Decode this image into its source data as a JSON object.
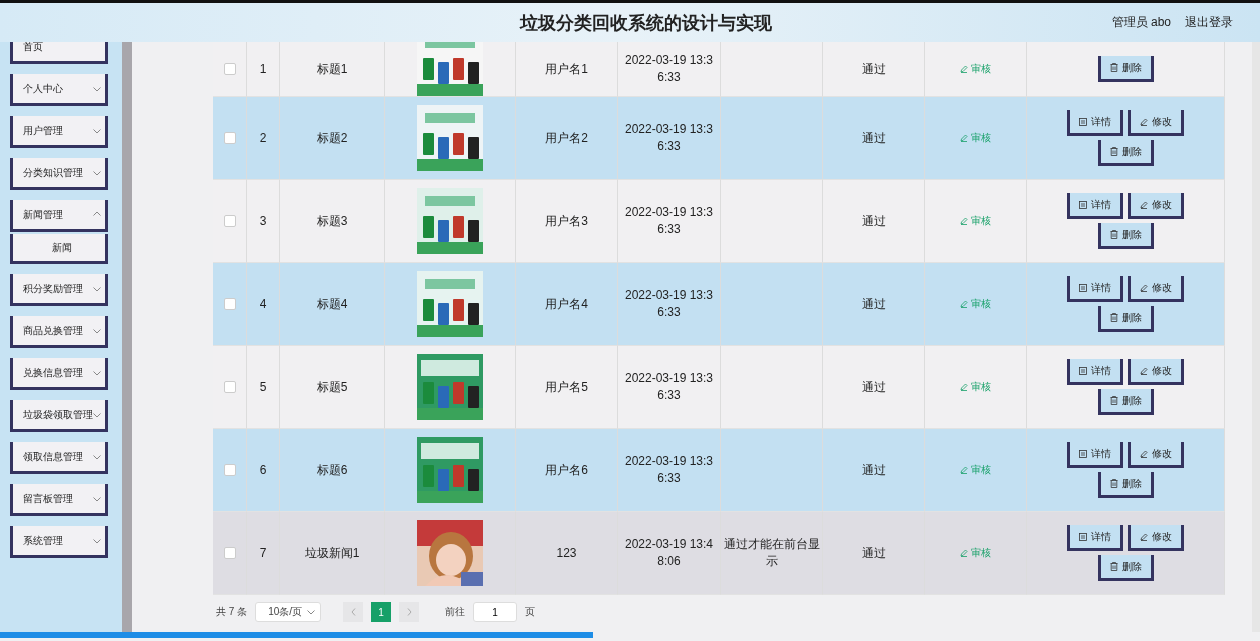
{
  "header": {
    "title": "垃圾分类回收系统的设计与实现",
    "user": "管理员 abo",
    "logout": "退出登录"
  },
  "sidebar": {
    "items": [
      {
        "label": "首页",
        "kind": "link"
      },
      {
        "label": "个人中心",
        "kind": "menu",
        "expanded": false
      },
      {
        "label": "用户管理",
        "kind": "menu",
        "expanded": false
      },
      {
        "label": "分类知识管理",
        "kind": "menu",
        "expanded": false
      },
      {
        "label": "新闻管理",
        "kind": "menu",
        "expanded": true,
        "children": [
          {
            "label": "新闻"
          }
        ]
      },
      {
        "label": "积分奖励管理",
        "kind": "menu",
        "expanded": false
      },
      {
        "label": "商品兑换管理",
        "kind": "menu",
        "expanded": false
      },
      {
        "label": "兑换信息管理",
        "kind": "menu",
        "expanded": false
      },
      {
        "label": "垃圾袋领取管理",
        "kind": "menu",
        "expanded": false
      },
      {
        "label": "领取信息管理",
        "kind": "menu",
        "expanded": false
      },
      {
        "label": "留言板管理",
        "kind": "menu",
        "expanded": false
      },
      {
        "label": "系统管理",
        "kind": "menu",
        "expanded": false
      }
    ]
  },
  "table": {
    "rows": [
      {
        "checked": false,
        "hovered": false,
        "index": "1",
        "title": "标题1",
        "username": "用户名1",
        "time": "2022-03-19 13:36:33",
        "status": "通过",
        "review": "审核",
        "actions": [
          "删除"
        ]
      },
      {
        "checked": false,
        "hovered": false,
        "index": "2",
        "title": "标题2",
        "username": "用户名2",
        "time": "2022-03-19 13:36:33",
        "status": "通过",
        "review": "审核",
        "actions": [
          "详情",
          "修改",
          "删除"
        ]
      },
      {
        "checked": false,
        "hovered": false,
        "index": "3",
        "title": "标题3",
        "username": "用户名3",
        "time": "2022-03-19 13:36:33",
        "status": "通过",
        "review": "审核",
        "actions": [
          "详情",
          "修改",
          "删除"
        ]
      },
      {
        "checked": false,
        "hovered": false,
        "index": "4",
        "title": "标题4",
        "username": "用户名4",
        "time": "2022-03-19 13:36:33",
        "status": "通过",
        "review": "审核",
        "actions": [
          "详情",
          "修改",
          "删除"
        ]
      },
      {
        "checked": false,
        "hovered": false,
        "index": "5",
        "title": "标题5",
        "username": "用户名5",
        "time": "2022-03-19 13:36:33",
        "status": "通过",
        "review": "审核",
        "actions": [
          "详情",
          "修改",
          "删除"
        ]
      },
      {
        "checked": false,
        "hovered": false,
        "index": "6",
        "title": "标题6",
        "username": "用户名6",
        "time": "2022-03-19 13:36:33",
        "status": "通过",
        "review": "审核",
        "actions": [
          "详情",
          "修改",
          "删除"
        ]
      },
      {
        "checked": false,
        "hovered": true,
        "index": "7",
        "title": "垃圾新闻1",
        "username": "123",
        "time": "2022-03-19 13:48:06",
        "note": "通过才能在前台显示",
        "status": "通过",
        "review": "审核",
        "actions": [
          "详情",
          "修改",
          "删除"
        ]
      }
    ]
  },
  "pagination": {
    "total": "共 7 条",
    "page_size": "10条/页",
    "pages": [
      {
        "label": "1",
        "selected": true
      }
    ],
    "goto_label": "前往",
    "goto_value": "1",
    "goto_suffix": "页"
  }
}
